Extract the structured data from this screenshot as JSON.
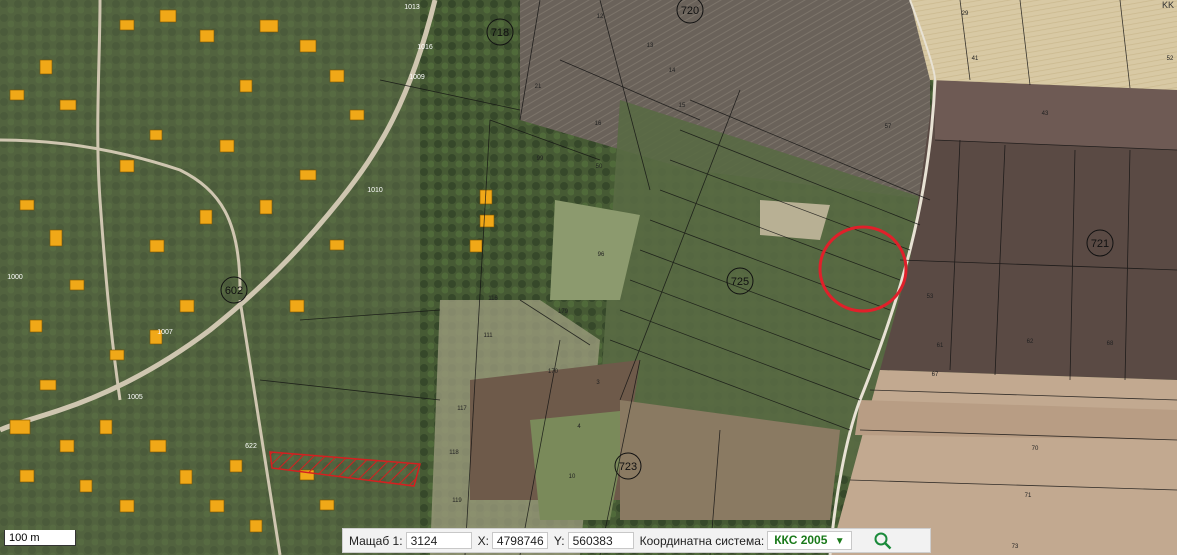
{
  "map": {
    "parcel_labels": [
      "718",
      "720",
      "721",
      "725",
      "723",
      "602",
      "622",
      "1009",
      "1010",
      "1005",
      "1013",
      "1016",
      "1000",
      "1007"
    ],
    "small_labels": [
      "29",
      "41",
      "52",
      "43",
      "53",
      "61",
      "62",
      "67",
      "70",
      "71",
      "73",
      "68",
      "57",
      "21",
      "15",
      "16",
      "14",
      "13",
      "12",
      "96",
      "99",
      "179",
      "170",
      "116",
      "117",
      "118",
      "119",
      "111",
      "3",
      "4",
      "50",
      "10"
    ],
    "highlight_color": "#e0202a",
    "hatch_color": "#d42020"
  },
  "scale_bar": {
    "label": "100 m"
  },
  "toolbar": {
    "scale_label": "Мащаб 1:",
    "scale_value": "3124",
    "x_label": "X:",
    "x_value": "4798746",
    "y_label": "Y:",
    "y_value": "560383",
    "crs_label": "Координатна система:",
    "crs_value": "ККС 2005",
    "dropdown_icon": "caret-down-icon",
    "search_icon": "search-icon"
  },
  "corner_text": "KK"
}
